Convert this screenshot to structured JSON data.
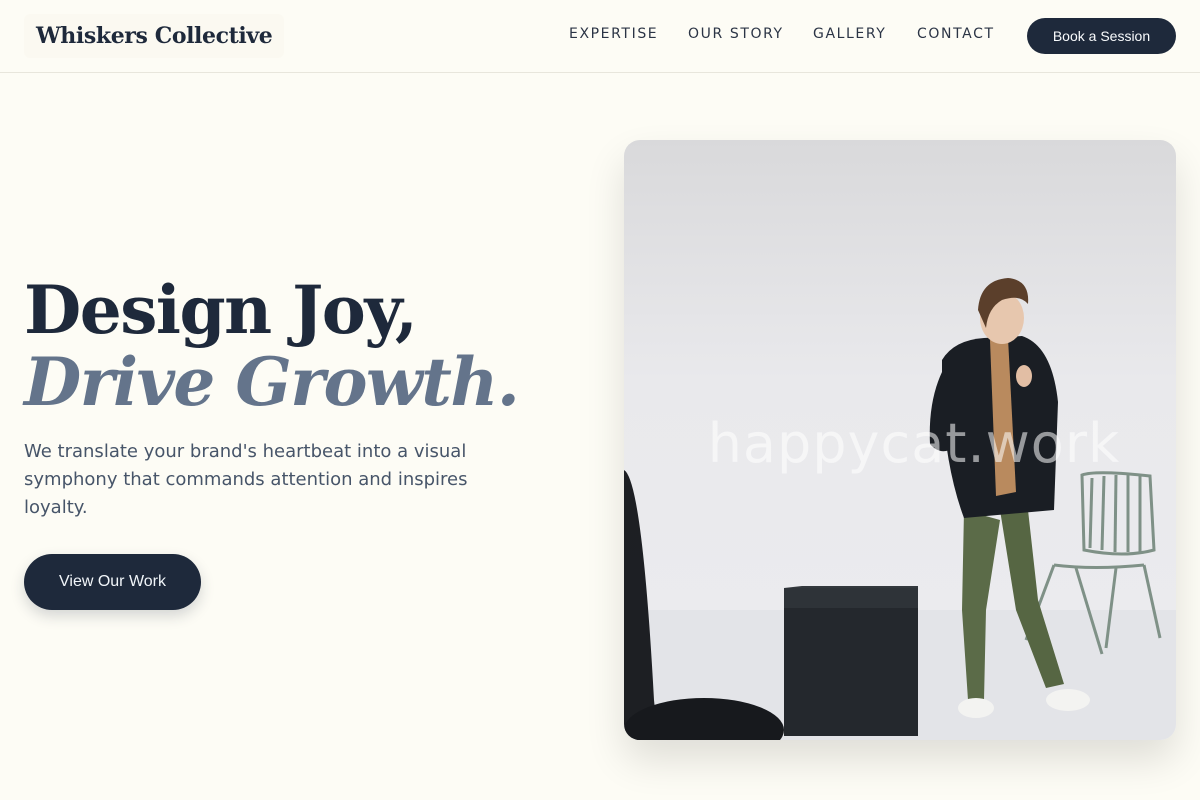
{
  "header": {
    "logo": "Whiskers Collective",
    "nav": [
      "EXPERTISE",
      "OUR STORY",
      "GALLERY",
      "CONTACT"
    ],
    "cta": "Book a Session"
  },
  "hero": {
    "title_line1": "Design Joy,",
    "title_line2": "Drive Growth.",
    "subtitle": "We translate your brand's heartbeat into a visual symphony that commands attention and inspires loyalty.",
    "button": "View Our Work"
  },
  "image": {
    "watermark": "happycat.work",
    "subject": "man-in-blazer-with-chair-photo"
  },
  "colors": {
    "background": "#fdfcf5",
    "primary": "#1e293b",
    "muted": "#64748b"
  }
}
